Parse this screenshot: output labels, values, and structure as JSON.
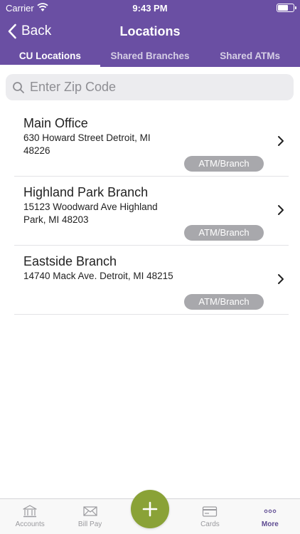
{
  "status_bar": {
    "carrier": "Carrier",
    "time": "9:43 PM"
  },
  "nav": {
    "back_label": "Back",
    "title": "Locations"
  },
  "tabs": [
    {
      "label": "CU Locations",
      "active": true
    },
    {
      "label": "Shared Branches",
      "active": false
    },
    {
      "label": "Shared ATMs",
      "active": false
    }
  ],
  "search": {
    "placeholder": "Enter Zip Code",
    "value": ""
  },
  "locations": [
    {
      "name": "Main Office",
      "address": "630 Howard Street Detroit, MI 48226",
      "badge": "ATM/Branch"
    },
    {
      "name": "Highland Park Branch",
      "address": "15123 Woodward Ave Highland Park, MI 48203",
      "badge": "ATM/Branch"
    },
    {
      "name": "Eastside Branch",
      "address": "14740 Mack Ave. Detroit, MI 48215",
      "badge": "ATM/Branch"
    }
  ],
  "tabbar": {
    "items": [
      {
        "label": "Accounts",
        "icon": "bank-icon"
      },
      {
        "label": "Bill Pay",
        "icon": "envelope-icon"
      },
      {
        "label": "Cards",
        "icon": "card-icon"
      },
      {
        "label": "More",
        "icon": "more-icon",
        "active": true
      }
    ],
    "fab_icon": "plus-icon"
  },
  "colors": {
    "header": "#6a4fa3",
    "fab": "#8aa237",
    "badge": "#a8a8ac",
    "active_tab_label": "#5d4a91"
  }
}
